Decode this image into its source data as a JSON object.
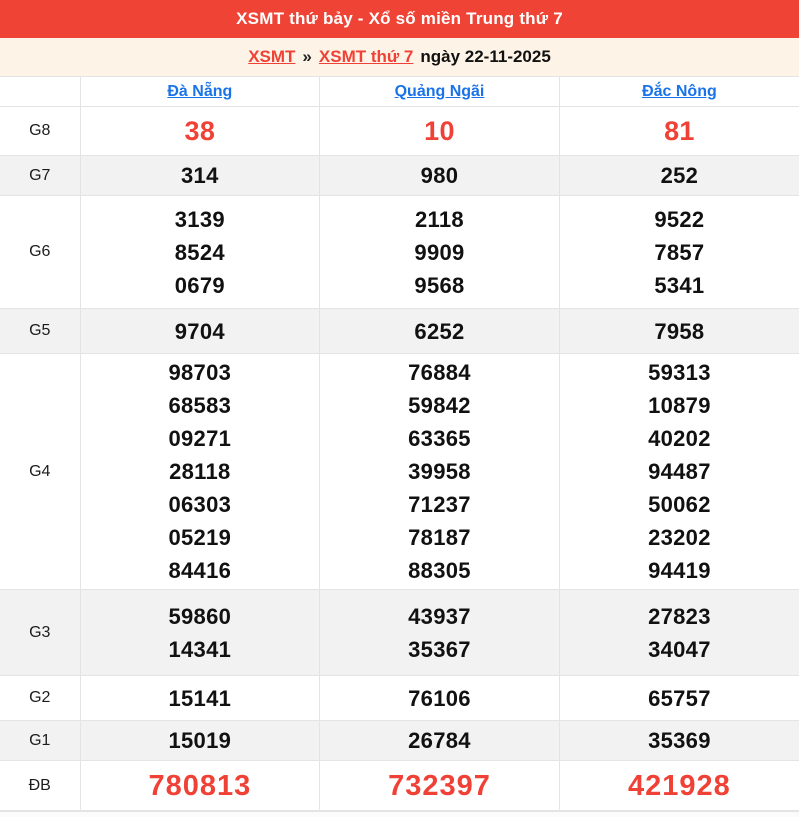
{
  "header": {
    "title": "XSMT thứ bảy - Xổ số miền Trung thứ 7"
  },
  "breadcrumb": {
    "home": "XSMT",
    "separator": "»",
    "current": "XSMT thứ 7",
    "date": "ngày 22-11-2025"
  },
  "table": {
    "provinces": [
      "Đà Nẵng",
      "Quảng Ngãi",
      "Đắc Nông"
    ],
    "rows": [
      {
        "label": "G8",
        "style": "red-large",
        "values": [
          [
            "38"
          ],
          [
            "10"
          ],
          [
            "81"
          ]
        ]
      },
      {
        "label": "G7",
        "values": [
          [
            "314"
          ],
          [
            "980"
          ],
          [
            "252"
          ]
        ]
      },
      {
        "label": "G6",
        "values": [
          [
            "3139",
            "8524",
            "0679"
          ],
          [
            "2118",
            "9909",
            "9568"
          ],
          [
            "9522",
            "7857",
            "5341"
          ]
        ]
      },
      {
        "label": "G5",
        "values": [
          [
            "9704"
          ],
          [
            "6252"
          ],
          [
            "7958"
          ]
        ]
      },
      {
        "label": "G4",
        "values": [
          [
            "98703",
            "68583",
            "09271",
            "28118",
            "06303",
            "05219",
            "84416"
          ],
          [
            "76884",
            "59842",
            "63365",
            "39958",
            "71237",
            "78187",
            "88305"
          ],
          [
            "59313",
            "10879",
            "40202",
            "94487",
            "50062",
            "23202",
            "94419"
          ]
        ]
      },
      {
        "label": "G3",
        "values": [
          [
            "59860",
            "14341"
          ],
          [
            "43937",
            "35367"
          ],
          [
            "27823",
            "34047"
          ]
        ]
      },
      {
        "label": "G2",
        "values": [
          [
            "15141"
          ],
          [
            "76106"
          ],
          [
            "65757"
          ]
        ]
      },
      {
        "label": "G1",
        "values": [
          [
            "15019"
          ],
          [
            "26784"
          ],
          [
            "35369"
          ]
        ]
      },
      {
        "label": "ĐB",
        "style": "red-xlarge",
        "values": [
          [
            "780813"
          ],
          [
            "732397"
          ],
          [
            "421928"
          ]
        ]
      }
    ]
  },
  "colors": {
    "header_bg": "#ef4336",
    "accent_red": "#f04136",
    "link_blue": "#1a73e8",
    "breadcrumb_bg": "#fdf3e6",
    "stripe_gray": "#f2f2f2",
    "border_gray": "#e4e4e4"
  }
}
